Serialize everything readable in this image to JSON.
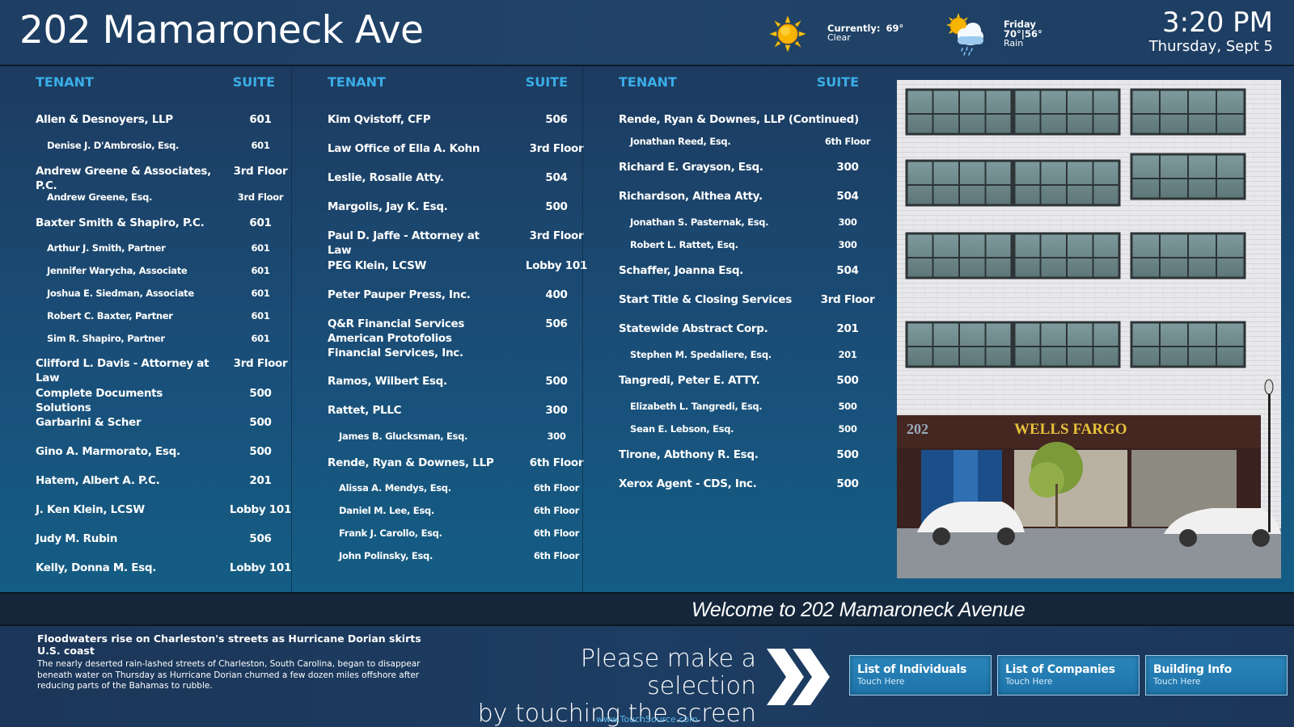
{
  "header": {
    "title": "202 Mamaroneck Ave",
    "weather_current": {
      "icon": "sun-icon",
      "label": "Currently:",
      "temp": "69°",
      "condition": "Clear"
    },
    "weather_forecast": {
      "icon": "sun-cloud-rain-icon",
      "day": "Friday",
      "temps": "70°|56°",
      "condition": "Rain"
    },
    "time": "3:20 PM",
    "date": "Thursday, Sept 5"
  },
  "directory": {
    "tenant_header": "TENANT",
    "suite_header": "SUITE",
    "columns": [
      [
        {
          "name": "Allen & Desnoyers, LLP",
          "suite": "601",
          "sub": false
        },
        {
          "name": "Denise J. D'Ambrosio, Esq.",
          "suite": "601",
          "sub": true
        },
        {
          "name": "Andrew Greene & Associates, P.C.",
          "suite": "3rd Floor",
          "sub": false
        },
        {
          "name": "Andrew Greene, Esq.",
          "suite": "3rd Floor",
          "sub": true
        },
        {
          "name": "Baxter Smith & Shapiro, P.C.",
          "suite": "601",
          "sub": false
        },
        {
          "name": "Arthur J. Smith, Partner",
          "suite": "601",
          "sub": true
        },
        {
          "name": "Jennifer Warycha, Associate",
          "suite": "601",
          "sub": true
        },
        {
          "name": "Joshua E. Siedman, Associate",
          "suite": "601",
          "sub": true
        },
        {
          "name": "Robert C. Baxter, Partner",
          "suite": "601",
          "sub": true
        },
        {
          "name": "Sim R. Shapiro, Partner",
          "suite": "601",
          "sub": true
        },
        {
          "name": "Clifford L. Davis - Attorney at Law",
          "suite": "3rd Floor",
          "sub": false
        },
        {
          "name": "Complete Documents Solutions",
          "suite": "500",
          "sub": false
        },
        {
          "name": "Garbarini & Scher",
          "suite": "500",
          "sub": false
        },
        {
          "name": "Gino A. Marmorato, Esq.",
          "suite": "500",
          "sub": false
        },
        {
          "name": "Hatem, Albert A. P.C.",
          "suite": "201",
          "sub": false
        },
        {
          "name": "J. Ken Klein, LCSW",
          "suite": "Lobby 101",
          "sub": false
        },
        {
          "name": "Judy M. Rubin",
          "suite": "506",
          "sub": false
        },
        {
          "name": "Kelly, Donna M. Esq.",
          "suite": "Lobby 101",
          "sub": false
        }
      ],
      [
        {
          "name": "Kim Qvistoff, CFP",
          "suite": "506",
          "sub": false
        },
        {
          "name": "Law Office of Ella A. Kohn",
          "suite": "3rd Floor",
          "sub": false
        },
        {
          "name": "Leslie, Rosalie Atty.",
          "suite": "504",
          "sub": false
        },
        {
          "name": "Margolis, Jay K. Esq.",
          "suite": "500",
          "sub": false
        },
        {
          "name": "Paul D. Jaffe - Attorney at Law",
          "suite": "3rd Floor",
          "sub": false
        },
        {
          "name": "PEG Klein, LCSW",
          "suite": "Lobby 101",
          "sub": false
        },
        {
          "name": "Peter Pauper Press, Inc.",
          "suite": "400",
          "sub": false
        },
        {
          "name": "Q&R Financial Services American Protofolios Financial Services, Inc.",
          "suite": "506",
          "sub": false
        },
        {
          "name": "Ramos, Wilbert Esq.",
          "suite": "500",
          "sub": false
        },
        {
          "name": "Rattet, PLLC",
          "suite": "300",
          "sub": false
        },
        {
          "name": "James B. Glucksman, Esq.",
          "suite": "300",
          "sub": true
        },
        {
          "name": "Rende, Ryan & Downes, LLP",
          "suite": "6th Floor",
          "sub": false
        },
        {
          "name": "Alissa A. Mendys, Esq.",
          "suite": "6th Floor",
          "sub": true
        },
        {
          "name": "Daniel M. Lee, Esq.",
          "suite": "6th Floor",
          "sub": true
        },
        {
          "name": "Frank J. Carollo, Esq.",
          "suite": "6th Floor",
          "sub": true
        },
        {
          "name": "John Polinsky, Esq.",
          "suite": "6th Floor",
          "sub": true
        }
      ],
      [
        {
          "name": "Rende, Ryan & Downes, LLP (Continued)",
          "suite": "",
          "sub": false
        },
        {
          "name": "Jonathan Reed, Esq.",
          "suite": "6th Floor",
          "sub": true
        },
        {
          "name": "Richard E. Grayson, Esq.",
          "suite": "300",
          "sub": false
        },
        {
          "name": "Richardson, Althea Atty.",
          "suite": "504",
          "sub": false
        },
        {
          "name": "Jonathan S. Pasternak, Esq.",
          "suite": "300",
          "sub": true
        },
        {
          "name": "Robert L. Rattet, Esq.",
          "suite": "300",
          "sub": true
        },
        {
          "name": "Schaffer, Joanna Esq.",
          "suite": "504",
          "sub": false
        },
        {
          "name": "Start Title & Closing Services",
          "suite": "3rd Floor",
          "sub": false
        },
        {
          "name": "Statewide Abstract Corp.",
          "suite": "201",
          "sub": false
        },
        {
          "name": "Stephen M. Spedaliere, Esq.",
          "suite": "201",
          "sub": true
        },
        {
          "name": "Tangredi, Peter E. ATTY.",
          "suite": "500",
          "sub": false
        },
        {
          "name": "Elizabeth L. Tangredi, Esq.",
          "suite": "500",
          "sub": true
        },
        {
          "name": "Sean E. Lebson, Esq.",
          "suite": "500",
          "sub": true
        },
        {
          "name": "Tirone, Abthony R. Esq.",
          "suite": "500",
          "sub": false
        },
        {
          "name": "Xerox Agent - CDS, Inc.",
          "suite": "500",
          "sub": false
        }
      ]
    ]
  },
  "photo": {
    "alt": "Building exterior photo",
    "signage_number": "202",
    "signage_bank": "WELLS FARGO"
  },
  "ticker": {
    "text": "Welcome to 202 Mamaroneck Avenue"
  },
  "news": {
    "title": "Floodwaters rise on Charleston's streets as Hurricane Dorian skirts U.S. coast",
    "body": "The nearly deserted rain-lashed streets of Charleston, South Carolina, began to disappear beneath water on Thursday as Hurricane Dorian churned a few dozen miles offshore after reducing parts of the Bahamas to rubble."
  },
  "prompt": {
    "line1": "Please make a selection",
    "line2": "by touching the screen",
    "icon": "double-chevron-right-icon"
  },
  "site_url": "www.TouchSource.com",
  "nav_buttons": [
    {
      "label": "List of Individuals",
      "sub": "Touch Here"
    },
    {
      "label": "List of Companies",
      "sub": "Touch Here"
    },
    {
      "label": "Building Info",
      "sub": "Touch Here"
    }
  ]
}
